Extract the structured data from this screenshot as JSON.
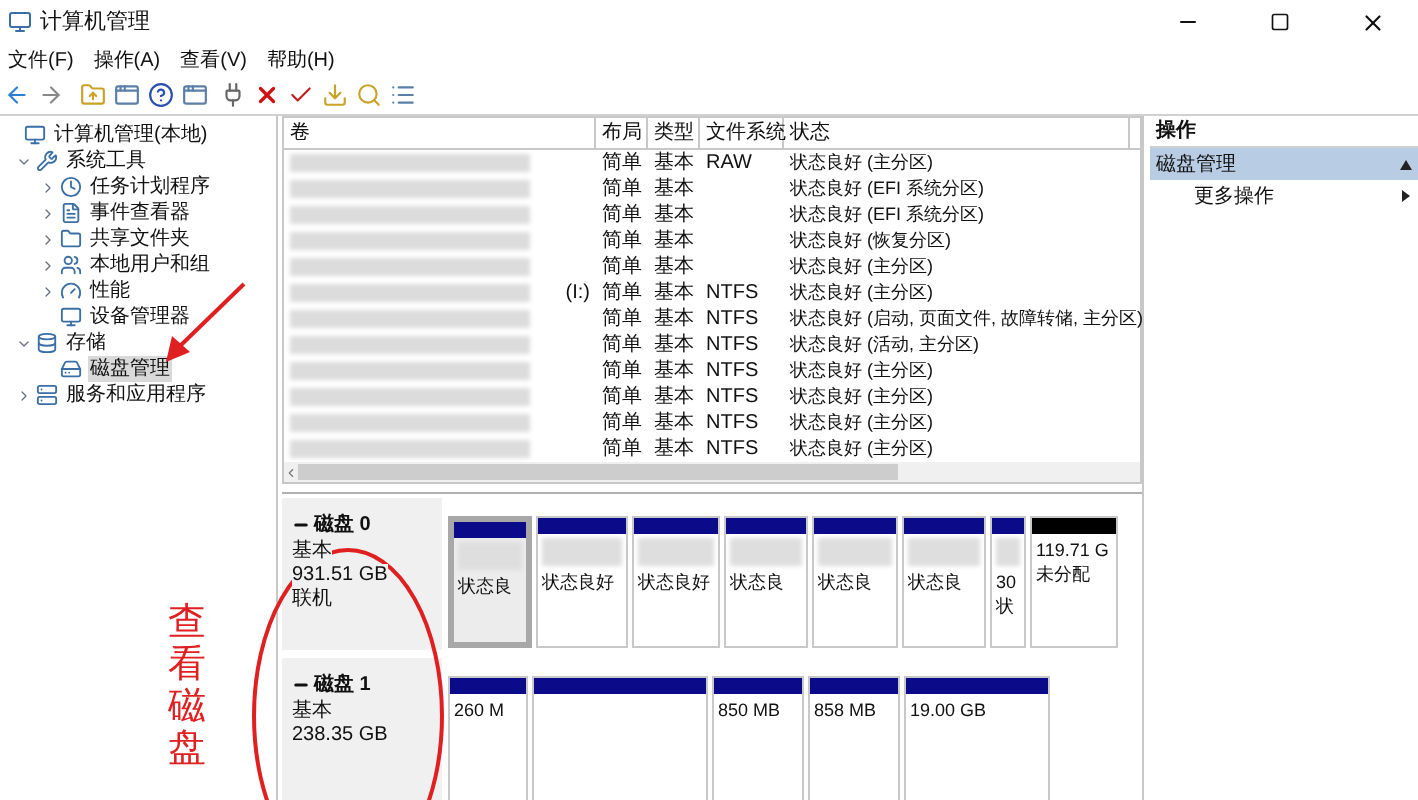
{
  "window": {
    "title": "计算机管理"
  },
  "menu": [
    "文件(F)",
    "操作(A)",
    "查看(V)",
    "帮助(H)"
  ],
  "tree": [
    {
      "label": "计算机管理(本地)",
      "children": [
        {
          "label": "系统工具",
          "expanded": true,
          "children": [
            {
              "label": "任务计划程序",
              "expanded": false,
              "selected": false
            },
            {
              "label": "事件查看器",
              "expanded": false,
              "selected": false
            },
            {
              "label": "共享文件夹",
              "expanded": false,
              "selected": false
            },
            {
              "label": "本地用户和组",
              "expanded": false,
              "selected": false
            },
            {
              "label": "性能",
              "expanded": false,
              "selected": false
            },
            {
              "label": "设备管理器",
              "selected": false
            }
          ]
        },
        {
          "label": "存储",
          "expanded": true,
          "children": [
            {
              "label": "磁盘管理",
              "selected": true
            }
          ]
        },
        {
          "label": "服务和应用程序",
          "expanded": false
        }
      ]
    }
  ],
  "table": {
    "columns": [
      "卷",
      "布局",
      "类型",
      "文件系统",
      "状态"
    ],
    "rows": [
      {
        "layout": "简单",
        "type": "基本",
        "fs": "RAW",
        "status": "状态良好 (主分区)"
      },
      {
        "layout": "简单",
        "type": "基本",
        "status": "状态良好 (EFI 系统分区)"
      },
      {
        "layout": "简单",
        "type": "基本",
        "status": "状态良好 (EFI 系统分区)"
      },
      {
        "layout": "简单",
        "type": "基本",
        "status": "状态良好 (恢复分区)"
      },
      {
        "layout": "简单",
        "type": "基本",
        "status": "状态良好 (主分区)"
      },
      {
        "volume": "(I:)",
        "layout": "简单",
        "type": "基本",
        "fs": "NTFS",
        "status": "状态良好 (主分区)"
      },
      {
        "layout": "简单",
        "type": "基本",
        "fs": "NTFS",
        "status": "状态良好 (启动, 页面文件, 故障转储, 主分区)"
      },
      {
        "layout": "简单",
        "type": "基本",
        "fs": "NTFS",
        "status": "状态良好 (活动, 主分区)"
      },
      {
        "layout": "简单",
        "type": "基本",
        "fs": "NTFS",
        "status": "状态良好 (主分区)"
      },
      {
        "layout": "简单",
        "type": "基本",
        "fs": "NTFS",
        "status": "状态良好 (主分区)"
      },
      {
        "layout": "简单",
        "type": "基本",
        "fs": "NTFS",
        "status": "状态良好 (主分区)"
      },
      {
        "layout": "简单",
        "type": "基本",
        "fs": "NTFS",
        "status": "状态良好 (主分区)"
      }
    ]
  },
  "disks": [
    {
      "name": "磁盘 0",
      "type": "基本",
      "size": "931.51 GB",
      "state": "联机",
      "partitions": [
        {
          "kind": "primary",
          "selected": true,
          "lines": [
            "状态良"
          ]
        },
        {
          "kind": "primary",
          "selected": false,
          "lines": [
            "状态良好"
          ]
        },
        {
          "kind": "primary",
          "selected": false,
          "lines": [
            "状态良好"
          ]
        },
        {
          "kind": "primary",
          "selected": false,
          "lines": [
            "状态良"
          ]
        },
        {
          "kind": "primary",
          "selected": false,
          "lines": [
            "状态良"
          ]
        },
        {
          "kind": "primary",
          "selected": false,
          "lines": [
            "状态良"
          ]
        },
        {
          "kind": "primary",
          "selected": false,
          "lines": [
            "30",
            "状"
          ]
        },
        {
          "kind": "unallocated",
          "selected": false,
          "lines": [
            "119.71 G",
            "未分配"
          ]
        }
      ]
    },
    {
      "name": "磁盘 1",
      "type": "基本",
      "size": "238.35 GB",
      "partitions": [
        {
          "kind": "primary",
          "selected": false,
          "lines": [
            "260 M"
          ]
        },
        {
          "kind": "primary",
          "selected": false
        },
        {
          "kind": "primary",
          "selected": false,
          "lines": [
            "850 MB"
          ]
        },
        {
          "kind": "primary",
          "selected": false,
          "lines": [
            "858 MB"
          ]
        },
        {
          "kind": "primary",
          "selected": false,
          "lines": [
            "19.00 GB"
          ]
        }
      ]
    }
  ],
  "actions": {
    "title": "操作",
    "section": {
      "label": "磁盘管理",
      "expanded": true
    },
    "items": [
      "更多操作"
    ]
  },
  "annotation": {
    "text": "查看磁盘"
  }
}
